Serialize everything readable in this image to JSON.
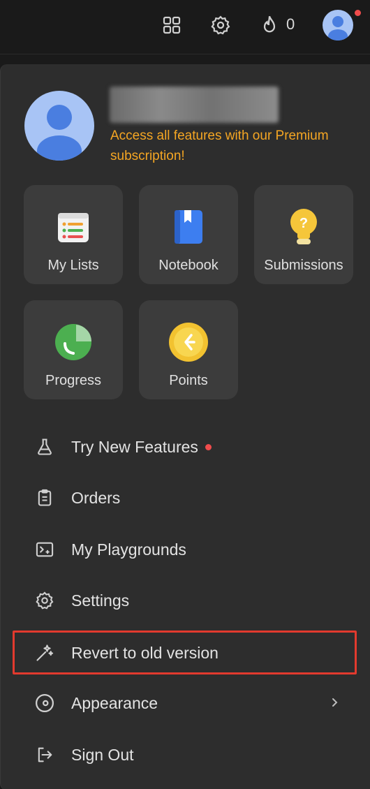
{
  "topbar": {
    "icons": [
      "apps-grid-icon",
      "gear-icon",
      "flame-icon",
      "avatar"
    ],
    "streak_count": "0"
  },
  "profile": {
    "premium_text": "Access all features with our Premium subscription!"
  },
  "tiles": [
    {
      "label": "My Lists",
      "icon": "list-icon"
    },
    {
      "label": "Notebook",
      "icon": "notebook-icon"
    },
    {
      "label": "Submissions",
      "icon": "lightbulb-icon"
    },
    {
      "label": "Progress",
      "icon": "pie-chart-icon"
    },
    {
      "label": "Points",
      "icon": "coin-icon"
    }
  ],
  "menu": [
    {
      "label": "Try New Features",
      "icon": "flask-icon"
    },
    {
      "label": "Orders",
      "icon": "clipboard-icon"
    },
    {
      "label": "My Playgrounds",
      "icon": "terminal-icon"
    },
    {
      "label": "Settings",
      "icon": "gear-icon"
    },
    {
      "label": "Revert to old version",
      "icon": "magic-wand-icon"
    },
    {
      "label": "Appearance",
      "icon": "appearance-icon"
    },
    {
      "label": "Sign Out",
      "icon": "sign-out-icon"
    }
  ],
  "colors": {
    "accent_premium": "#f5a623",
    "notification_dot": "#f04c4c",
    "highlight_frame": "#e23a2e",
    "panel_bg": "#2d2d2d",
    "tile_bg": "#3c3c3c"
  }
}
